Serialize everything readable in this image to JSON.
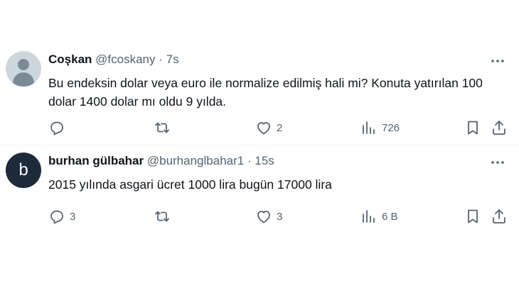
{
  "tweets": [
    {
      "avatar": "default-avatar",
      "name": "Coşkan",
      "handle": "@fcoskany",
      "separator": "·",
      "time": "7s",
      "text": "Bu endeksin dolar veya euro ile normalize edilmiş hali mi? Konuta yatırılan 100 dolar 1400 dolar mı oldu 9 yılda.",
      "reply_count": "",
      "retweet_count": "",
      "like_count": "2",
      "view_count": "726"
    },
    {
      "avatar_letter": "b",
      "name": "burhan gülbahar",
      "handle": "@burhanglbahar1",
      "separator": "·",
      "time": "15s",
      "text": "2015 yılında asgari ücret 1000 lira bugün 17000 lira",
      "reply_count": "3",
      "retweet_count": "",
      "like_count": "3",
      "view_count": "6 B"
    }
  ],
  "icons": {
    "more": "more-icon",
    "reply": "reply-icon",
    "retweet": "retweet-icon",
    "like": "like-icon",
    "views": "views-icon",
    "bookmark": "bookmark-icon",
    "share": "share-icon"
  },
  "colors": {
    "text": "#0f1419",
    "secondary": "#536471",
    "divider": "#eff3f4",
    "avatar_b": "#1d2a3a"
  }
}
